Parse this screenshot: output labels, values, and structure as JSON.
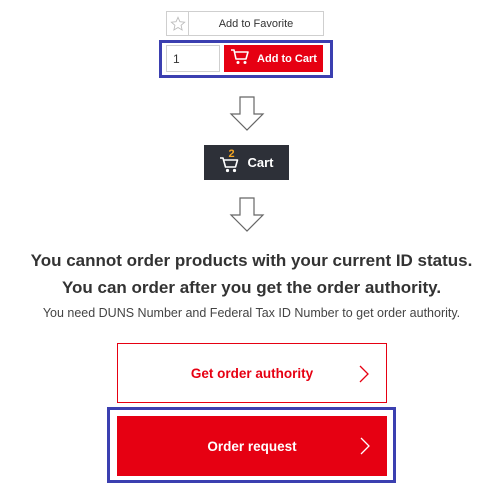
{
  "favorite": {
    "label": "Add to Favorite",
    "icon": "star-outline-icon"
  },
  "cart_form": {
    "quantity": "1",
    "add_label": "Add to Cart",
    "icon": "cart-icon"
  },
  "cart_button": {
    "label": "Cart",
    "count": "2"
  },
  "message": {
    "line1": "You cannot order products with your current ID status.",
    "line2": "You can order after you get the order authority.",
    "sub": "You need DUNS Number and Federal Tax ID Number to get order authority."
  },
  "buttons": {
    "authority_label": "Get order authority",
    "order_label": "Order request"
  },
  "colors": {
    "accent": "#e60012",
    "highlight": "#3b3fb0",
    "dark": "#2d3038"
  }
}
